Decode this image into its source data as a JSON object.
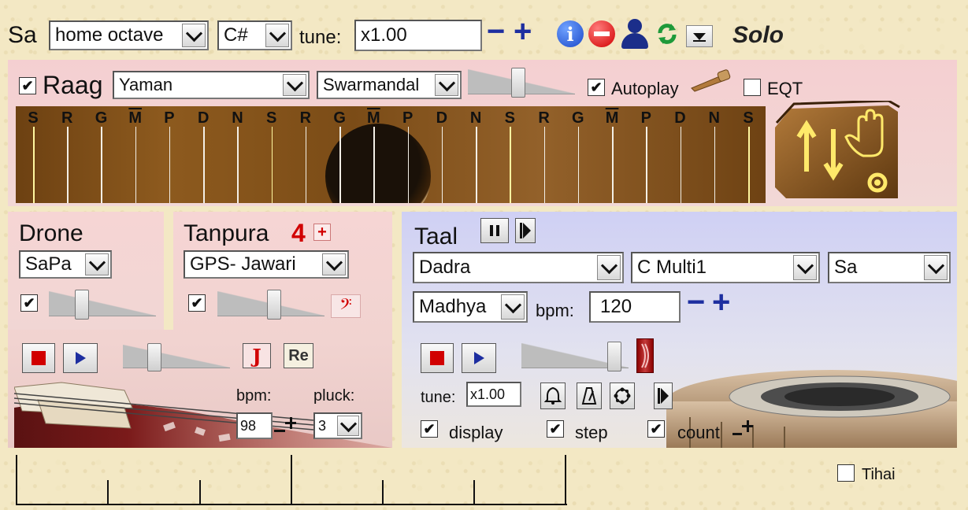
{
  "topbar": {
    "sa_label": "Sa",
    "octave_value": "home octave",
    "key_value": "C#",
    "tune_label": "tune:",
    "tune_value": "x1.00",
    "minus": "−",
    "plus": "+",
    "solo_label": "Solo"
  },
  "raag": {
    "label": "Raag",
    "checked": true,
    "raag_value": "Yaman",
    "instrument_value": "Swarmandal",
    "volume": 0.47,
    "autoplay_label": "Autoplay",
    "autoplay_checked": true,
    "eqt_label": "EQT",
    "eqt_checked": false,
    "notes": [
      "S",
      "R",
      "G",
      "M",
      "P",
      "D",
      "N",
      "S",
      "R",
      "G",
      "M",
      "P",
      "D",
      "N",
      "S",
      "R",
      "G",
      "M",
      "P",
      "D",
      "N",
      "S"
    ]
  },
  "drone": {
    "title": "Drone",
    "value": "SaPa",
    "checked": true,
    "volume": 0.28
  },
  "tanpura": {
    "title": "Tanpura",
    "count": "4",
    "add": "+",
    "value": "GPS- Jawari",
    "checked": true,
    "volume": 0.53,
    "j_label": "J",
    "re_label": "Re",
    "bpm_label": "bpm:",
    "bpm_value": "98",
    "pluck_label": "pluck:",
    "pluck_value": "3",
    "play_volume": 0.26
  },
  "taal": {
    "title": "Taal",
    "taal_value": "Dadra",
    "kit_value": "C Multi1",
    "start_value": "Sa",
    "laya_value": "Madhya",
    "bpm_label": "bpm:",
    "bpm_value": "120",
    "volume": 0.92,
    "tune_label": "tune:",
    "tune_value": "x1.00",
    "display_label": "display",
    "display_checked": true,
    "step_label": "step",
    "step_checked": true,
    "count_label": "count",
    "count_checked": true
  },
  "tihai": {
    "label": "Tihai",
    "checked": false
  },
  "colors": {
    "accent_blue": "#1d2ea0",
    "red_stop": "#d10000",
    "pink_panel": "#f4cfd1",
    "lavender_panel": "#d9daf3",
    "wood": "#8a5a1c"
  }
}
